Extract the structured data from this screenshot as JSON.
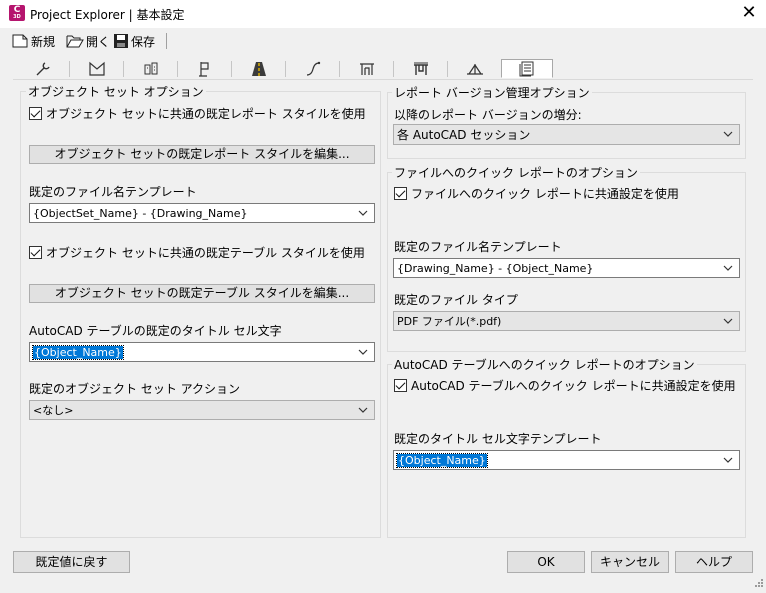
{
  "window": {
    "title": "Project Explorer | 基本設定",
    "app_icon_letter": "C",
    "app_icon_sub": "3D",
    "close_glyph": "✕"
  },
  "toolbar": {
    "new_label": "新規",
    "open_label": "開く",
    "save_label": "保存"
  },
  "tabs": [
    {
      "icon": "wrench-icon"
    },
    {
      "icon": "surface-icon"
    },
    {
      "icon": "parcel-icon"
    },
    {
      "icon": "flag-icon"
    },
    {
      "icon": "road-icon"
    },
    {
      "icon": "alignment-icon"
    },
    {
      "icon": "profile-icon"
    },
    {
      "icon": "corridor-icon"
    },
    {
      "icon": "grading-icon"
    },
    {
      "icon": "report-settings-icon",
      "selected": true
    }
  ],
  "object_set_options": {
    "legend": "オブジェクト セット オプション",
    "use_common_report_style": "オブジェクト セットに共通の既定レポート スタイルを使用",
    "edit_report_style_button": "オブジェクト セットの既定レポート スタイルを編集...",
    "filename_template_label": "既定のファイル名テンプレート",
    "filename_template_value": "{ObjectSet_Name} - {Drawing_Name}",
    "use_common_table_style": "オブジェクト セットに共通の既定テーブル スタイルを使用",
    "edit_table_style_button": "オブジェクト セットの既定テーブル スタイルを編集...",
    "table_title_label": "AutoCAD テーブルの既定のタイトル セル文字",
    "table_title_value": "{Object_Name}",
    "default_action_label": "既定のオブジェクト セット アクション",
    "default_action_value": "<なし>"
  },
  "report_version": {
    "legend": "レポート バージョン管理オプション",
    "increment_label": "以降のレポート バージョンの増分:",
    "increment_value": "各 AutoCAD セッション"
  },
  "quick_file": {
    "legend": "ファイルへのクイック レポートのオプション",
    "use_common": "ファイルへのクイック レポートに共通設定を使用",
    "filename_template_label": "既定のファイル名テンプレート",
    "filename_template_value": "{Drawing_Name} - {Object_Name}",
    "file_type_label": "既定のファイル タイプ",
    "file_type_value": "PDF ファイル(*.pdf)"
  },
  "quick_table": {
    "legend": "AutoCAD テーブルへのクイック レポートのオプション",
    "use_common": "AutoCAD テーブルへのクイック レポートに共通設定を使用",
    "title_template_label": "既定のタイトル セル文字テンプレート",
    "title_template_value": "{Object_Name}"
  },
  "footer": {
    "reset_button": "既定値に戻す",
    "ok_button": "OK",
    "cancel_button": "キャンセル",
    "help_button": "ヘルプ"
  },
  "colors": {
    "app_icon": "#b5156e",
    "selection": "#0078d7",
    "dialog_bg": "#f0f0f0"
  }
}
